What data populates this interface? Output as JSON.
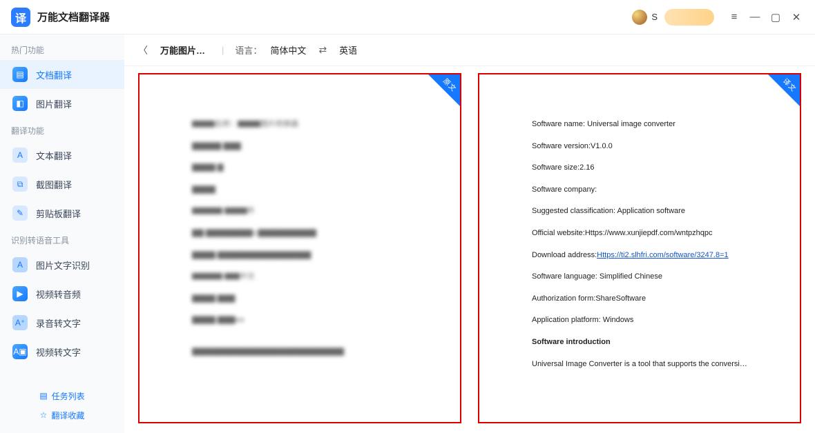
{
  "app": {
    "title": "万能文档翻译器",
    "logo_glyph": "译"
  },
  "user": {
    "initial": "S"
  },
  "sidebar": {
    "section1": "热门功能",
    "items1": [
      {
        "label": "文档翻译"
      },
      {
        "label": "图片翻译"
      }
    ],
    "section2": "翻译功能",
    "items2": [
      {
        "label": "文本翻译"
      },
      {
        "label": "截图翻译"
      },
      {
        "label": "剪贴板翻译"
      }
    ],
    "section3": "识别转语音工具",
    "items3": [
      {
        "label": "图片文字识别"
      },
      {
        "label": "视频转音频"
      },
      {
        "label": "录音转文字"
      },
      {
        "label": "视频转文字"
      }
    ],
    "bottom": {
      "tasks": "任务列表",
      "favs": "翻译收藏"
    }
  },
  "topbar": {
    "crumb": "万能图片…",
    "lang_key": "语言：",
    "src_lang": "简体中文",
    "dst_lang": "英语"
  },
  "panels": {
    "corner_src": "原文",
    "corner_dst": "译文"
  },
  "source_doc": {
    "lines": [
      "▇▇▇名称：▇▇▇图片转换器",
      "▇▇▇▇▇ ▇▇▇",
      "▇▇▇▇ ▇",
      "▇▇▇▇",
      "▇▇▇▇ ▇▇▇件",
      "▇▇ ▇▇▇▇▇▇▇▇v.▇▇▇▇▇▇▇▇▇▇",
      "▇▇▇▇ ▇▇▇▇▇▇▇▇▇▇▇▇▇▇▇▇",
      "▇▇▇▇ ▇▇中文",
      "▇▇▇▇ ▇▇▇",
      "▇▇▇▇ ▇▇▇ws",
      "",
      "▇▇▇▇▇▇▇▇▇▇▇▇▇▇▇▇▇▇▇▇▇▇▇▇▇▇"
    ]
  },
  "translated_doc": {
    "l1": "Software name: Universal image converter",
    "l2": "Software version:V1.0.0",
    "l3": "Software size:2.16",
    "l4": "Software company:",
    "l5": "Suggested classification: Application software",
    "l6_pre": "Official website:Https://www.xunjiepdf.com/wntpzhqpc",
    "l7_pre": "Download address:",
    "l7_link": "Https://ti2.slhfri.com/software/3247.8=1",
    "l8": "Software language: Simplified Chinese",
    "l9": "Authorization form:ShareSoftware",
    "l10": "Application platform: Windows",
    "l11": "Software introduction",
    "l12": "Universal Image Converter is a tool that supports the conversion and"
  }
}
